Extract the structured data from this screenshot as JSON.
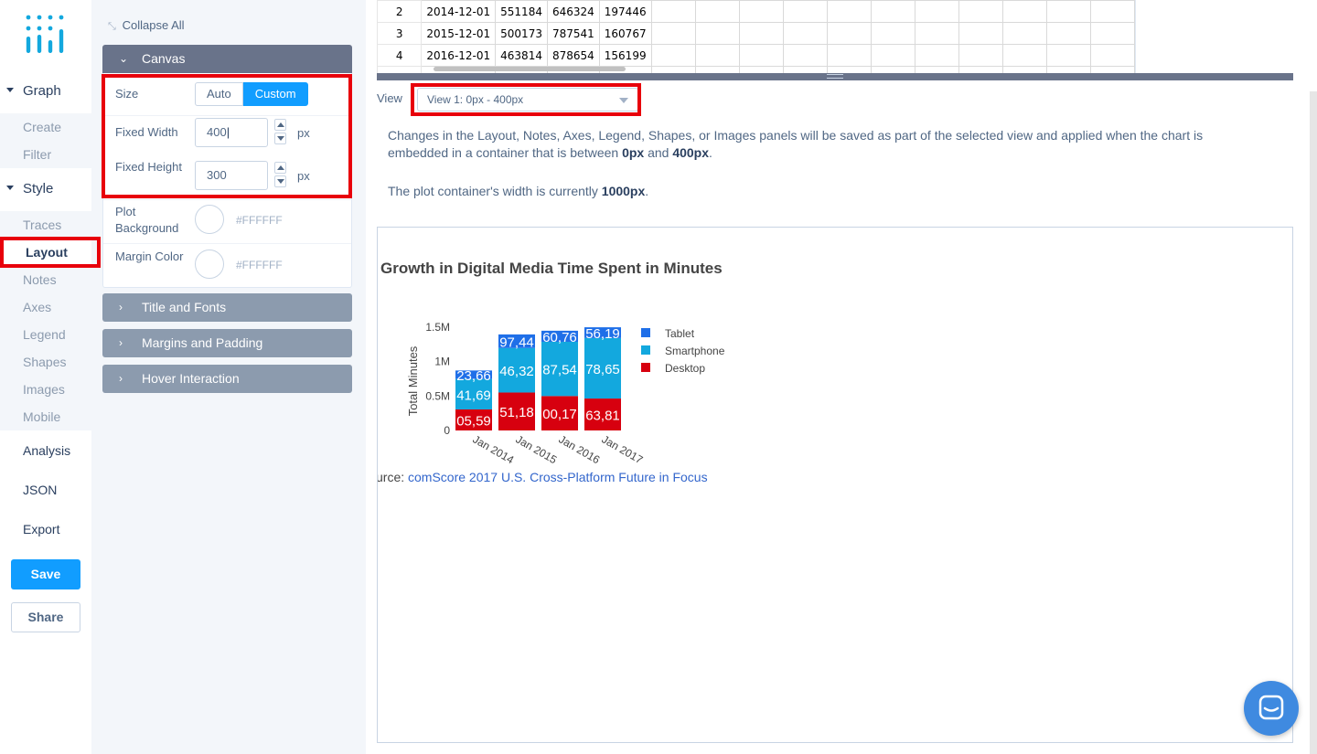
{
  "nav": {
    "groups": [
      {
        "label": "Graph",
        "items": [
          "Create",
          "Filter"
        ]
      },
      {
        "label": "Style",
        "items": [
          "Traces",
          "Layout",
          "Notes",
          "Axes",
          "Legend",
          "Shapes",
          "Images",
          "Mobile"
        ]
      }
    ],
    "active_item": "Layout",
    "extra": [
      "Analysis",
      "JSON",
      "Export"
    ],
    "save_label": "Save",
    "share_label": "Share"
  },
  "panel": {
    "collapse_all": "Collapse All",
    "canvas": {
      "title": "Canvas",
      "size_label": "Size",
      "size_options": [
        "Auto",
        "Custom"
      ],
      "size_selected": "Custom",
      "fixed_width_label": "Fixed Width",
      "fixed_width_value": "400",
      "fixed_height_label": "Fixed Height",
      "fixed_height_value": "300",
      "unit": "px",
      "plot_bg_label": "Plot Background",
      "plot_bg_value": "#FFFFFF",
      "margin_color_label": "Margin Color",
      "margin_color_value": "#FFFFFF"
    },
    "sections": [
      "Title and Fonts",
      "Margins and Padding",
      "Hover Interaction"
    ]
  },
  "grid": {
    "rows": [
      [
        "2",
        "2014-12-01",
        "551184",
        "646324",
        "197446"
      ],
      [
        "3",
        "2015-12-01",
        "500173",
        "787541",
        "160767"
      ],
      [
        "4",
        "2016-12-01",
        "463814",
        "878654",
        "156199"
      ]
    ],
    "partial_row_index": "5"
  },
  "view": {
    "label": "View",
    "selected": "View 1: 0px - 400px"
  },
  "info": {
    "text_a": "Changes in the Layout, Notes, Axes, Legend, Shapes, or Images panels will be saved as part of the selected view and applied when the chart is embedded in a container that is between ",
    "min": "0px",
    "text_b": " and ",
    "max": "400px",
    "text_c": ".",
    "width_text": "The plot container's width is currently ",
    "width_value": "1000px",
    "width_end": "."
  },
  "plot": {
    "title": "Growth in Digital Media Time Spent in Minutes",
    "source_prefix": "urce: ",
    "source_link": "comScore 2017 U.S. Cross-Platform Future in Focus"
  },
  "colors": {
    "tablet": "#1f6fe8",
    "smartphone": "#13a8de",
    "desktop": "#d7000f",
    "accent": "#119dff",
    "highlight": "#e8000b"
  },
  "chart_data": {
    "type": "bar",
    "stacked": true,
    "categories": [
      "Jan 2014",
      "Jan 2015",
      "Jan 2016",
      "Jan 2017"
    ],
    "series": [
      {
        "name": "Desktop",
        "values": [
          305594,
          551184,
          500173,
          463814
        ],
        "labels": [
          "05,59",
          "51,18",
          "00,17",
          "63,81"
        ]
      },
      {
        "name": "Smartphone",
        "values": [
          441690,
          646324,
          787541,
          878654
        ],
        "labels": [
          "41,69",
          "46,32",
          "87,54",
          "78,65"
        ]
      },
      {
        "name": "Tablet",
        "values": [
          123660,
          197446,
          160767,
          156199
        ],
        "labels": [
          "23,66",
          "97,44",
          "60,76",
          "56,19"
        ]
      }
    ],
    "ylabel": "Total Minutes",
    "yticks": [
      "0",
      "0.5M",
      "1M",
      "1.5M"
    ],
    "ylim": [
      0,
      1500000
    ],
    "legend": [
      "Tablet",
      "Smartphone",
      "Desktop"
    ],
    "legend_position": "right"
  }
}
